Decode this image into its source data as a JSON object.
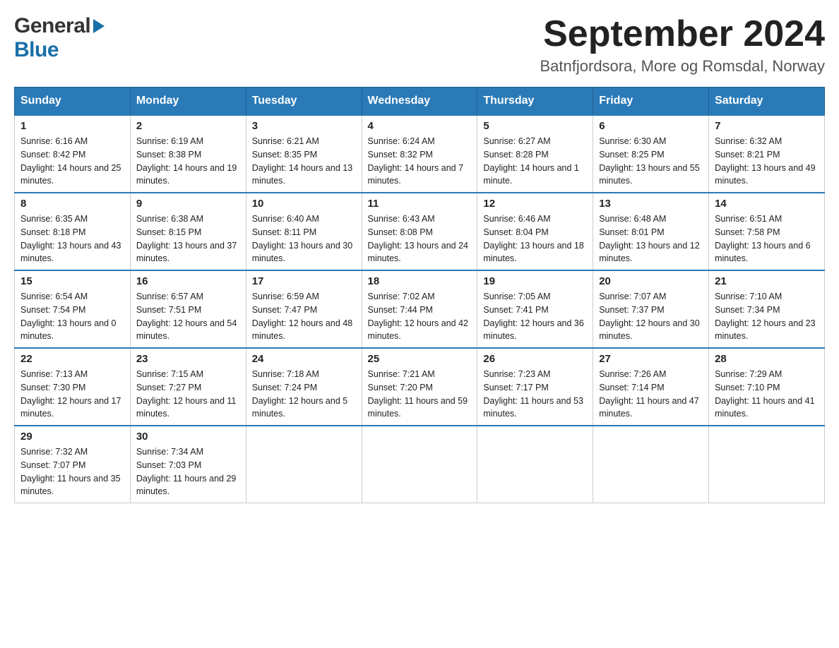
{
  "logo": {
    "general": "General",
    "blue": "Blue"
  },
  "header": {
    "month": "September 2024",
    "location": "Batnfjordsora, More og Romsdal, Norway"
  },
  "weekdays": [
    "Sunday",
    "Monday",
    "Tuesday",
    "Wednesday",
    "Thursday",
    "Friday",
    "Saturday"
  ],
  "weeks": [
    [
      {
        "day": "1",
        "sunrise": "Sunrise: 6:16 AM",
        "sunset": "Sunset: 8:42 PM",
        "daylight": "Daylight: 14 hours and 25 minutes."
      },
      {
        "day": "2",
        "sunrise": "Sunrise: 6:19 AM",
        "sunset": "Sunset: 8:38 PM",
        "daylight": "Daylight: 14 hours and 19 minutes."
      },
      {
        "day": "3",
        "sunrise": "Sunrise: 6:21 AM",
        "sunset": "Sunset: 8:35 PM",
        "daylight": "Daylight: 14 hours and 13 minutes."
      },
      {
        "day": "4",
        "sunrise": "Sunrise: 6:24 AM",
        "sunset": "Sunset: 8:32 PM",
        "daylight": "Daylight: 14 hours and 7 minutes."
      },
      {
        "day": "5",
        "sunrise": "Sunrise: 6:27 AM",
        "sunset": "Sunset: 8:28 PM",
        "daylight": "Daylight: 14 hours and 1 minute."
      },
      {
        "day": "6",
        "sunrise": "Sunrise: 6:30 AM",
        "sunset": "Sunset: 8:25 PM",
        "daylight": "Daylight: 13 hours and 55 minutes."
      },
      {
        "day": "7",
        "sunrise": "Sunrise: 6:32 AM",
        "sunset": "Sunset: 8:21 PM",
        "daylight": "Daylight: 13 hours and 49 minutes."
      }
    ],
    [
      {
        "day": "8",
        "sunrise": "Sunrise: 6:35 AM",
        "sunset": "Sunset: 8:18 PM",
        "daylight": "Daylight: 13 hours and 43 minutes."
      },
      {
        "day": "9",
        "sunrise": "Sunrise: 6:38 AM",
        "sunset": "Sunset: 8:15 PM",
        "daylight": "Daylight: 13 hours and 37 minutes."
      },
      {
        "day": "10",
        "sunrise": "Sunrise: 6:40 AM",
        "sunset": "Sunset: 8:11 PM",
        "daylight": "Daylight: 13 hours and 30 minutes."
      },
      {
        "day": "11",
        "sunrise": "Sunrise: 6:43 AM",
        "sunset": "Sunset: 8:08 PM",
        "daylight": "Daylight: 13 hours and 24 minutes."
      },
      {
        "day": "12",
        "sunrise": "Sunrise: 6:46 AM",
        "sunset": "Sunset: 8:04 PM",
        "daylight": "Daylight: 13 hours and 18 minutes."
      },
      {
        "day": "13",
        "sunrise": "Sunrise: 6:48 AM",
        "sunset": "Sunset: 8:01 PM",
        "daylight": "Daylight: 13 hours and 12 minutes."
      },
      {
        "day": "14",
        "sunrise": "Sunrise: 6:51 AM",
        "sunset": "Sunset: 7:58 PM",
        "daylight": "Daylight: 13 hours and 6 minutes."
      }
    ],
    [
      {
        "day": "15",
        "sunrise": "Sunrise: 6:54 AM",
        "sunset": "Sunset: 7:54 PM",
        "daylight": "Daylight: 13 hours and 0 minutes."
      },
      {
        "day": "16",
        "sunrise": "Sunrise: 6:57 AM",
        "sunset": "Sunset: 7:51 PM",
        "daylight": "Daylight: 12 hours and 54 minutes."
      },
      {
        "day": "17",
        "sunrise": "Sunrise: 6:59 AM",
        "sunset": "Sunset: 7:47 PM",
        "daylight": "Daylight: 12 hours and 48 minutes."
      },
      {
        "day": "18",
        "sunrise": "Sunrise: 7:02 AM",
        "sunset": "Sunset: 7:44 PM",
        "daylight": "Daylight: 12 hours and 42 minutes."
      },
      {
        "day": "19",
        "sunrise": "Sunrise: 7:05 AM",
        "sunset": "Sunset: 7:41 PM",
        "daylight": "Daylight: 12 hours and 36 minutes."
      },
      {
        "day": "20",
        "sunrise": "Sunrise: 7:07 AM",
        "sunset": "Sunset: 7:37 PM",
        "daylight": "Daylight: 12 hours and 30 minutes."
      },
      {
        "day": "21",
        "sunrise": "Sunrise: 7:10 AM",
        "sunset": "Sunset: 7:34 PM",
        "daylight": "Daylight: 12 hours and 23 minutes."
      }
    ],
    [
      {
        "day": "22",
        "sunrise": "Sunrise: 7:13 AM",
        "sunset": "Sunset: 7:30 PM",
        "daylight": "Daylight: 12 hours and 17 minutes."
      },
      {
        "day": "23",
        "sunrise": "Sunrise: 7:15 AM",
        "sunset": "Sunset: 7:27 PM",
        "daylight": "Daylight: 12 hours and 11 minutes."
      },
      {
        "day": "24",
        "sunrise": "Sunrise: 7:18 AM",
        "sunset": "Sunset: 7:24 PM",
        "daylight": "Daylight: 12 hours and 5 minutes."
      },
      {
        "day": "25",
        "sunrise": "Sunrise: 7:21 AM",
        "sunset": "Sunset: 7:20 PM",
        "daylight": "Daylight: 11 hours and 59 minutes."
      },
      {
        "day": "26",
        "sunrise": "Sunrise: 7:23 AM",
        "sunset": "Sunset: 7:17 PM",
        "daylight": "Daylight: 11 hours and 53 minutes."
      },
      {
        "day": "27",
        "sunrise": "Sunrise: 7:26 AM",
        "sunset": "Sunset: 7:14 PM",
        "daylight": "Daylight: 11 hours and 47 minutes."
      },
      {
        "day": "28",
        "sunrise": "Sunrise: 7:29 AM",
        "sunset": "Sunset: 7:10 PM",
        "daylight": "Daylight: 11 hours and 41 minutes."
      }
    ],
    [
      {
        "day": "29",
        "sunrise": "Sunrise: 7:32 AM",
        "sunset": "Sunset: 7:07 PM",
        "daylight": "Daylight: 11 hours and 35 minutes."
      },
      {
        "day": "30",
        "sunrise": "Sunrise: 7:34 AM",
        "sunset": "Sunset: 7:03 PM",
        "daylight": "Daylight: 11 hours and 29 minutes."
      },
      null,
      null,
      null,
      null,
      null
    ]
  ]
}
